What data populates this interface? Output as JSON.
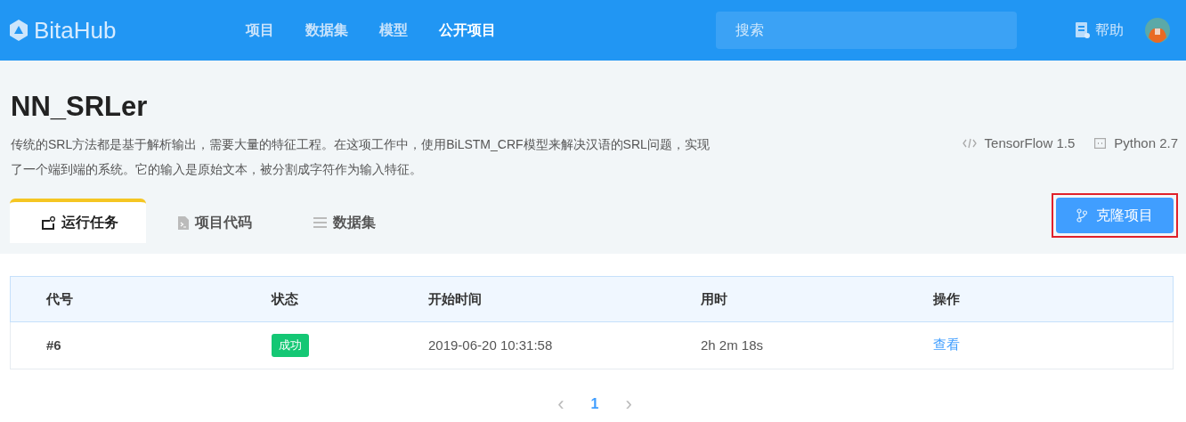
{
  "header": {
    "logo": "BitaHub",
    "nav": [
      {
        "label": "项目",
        "selected": false
      },
      {
        "label": "数据集",
        "selected": false
      },
      {
        "label": "模型",
        "selected": false
      },
      {
        "label": "公开项目",
        "selected": true
      }
    ],
    "search": {
      "placeholder": "搜索"
    },
    "help": "帮助"
  },
  "project": {
    "title": "NN_SRLer",
    "description": "传统的SRL方法都是基于解析输出，需要大量的特征工程。在这项工作中，使用BiLSTM_CRF模型来解决汉语的SRL问题，实现了一个端到端的系统。它的输入是原始文本，被分割成字符作为输入特征。",
    "framework": "TensorFlow 1.5",
    "language": "Python 2.7"
  },
  "tabs": [
    {
      "label": "运行任务",
      "kind": "tasks",
      "selected": true
    },
    {
      "label": "项目代码",
      "kind": "code",
      "selected": false
    },
    {
      "label": "数据集",
      "kind": "data",
      "selected": false
    }
  ],
  "clone_button": {
    "label": "克隆项目",
    "highlighted": true
  },
  "table": {
    "columns": [
      "代号",
      "状态",
      "开始时间",
      "用时",
      "操作"
    ],
    "rows": [
      {
        "id": "#6",
        "status": "成功",
        "start": "2019-06-20 10:31:58",
        "duration": "2h 2m 18s",
        "action": "查看"
      }
    ]
  },
  "pagination": {
    "prev": "‹",
    "pages": [
      {
        "label": "1",
        "selected": true
      }
    ],
    "next": "›"
  }
}
